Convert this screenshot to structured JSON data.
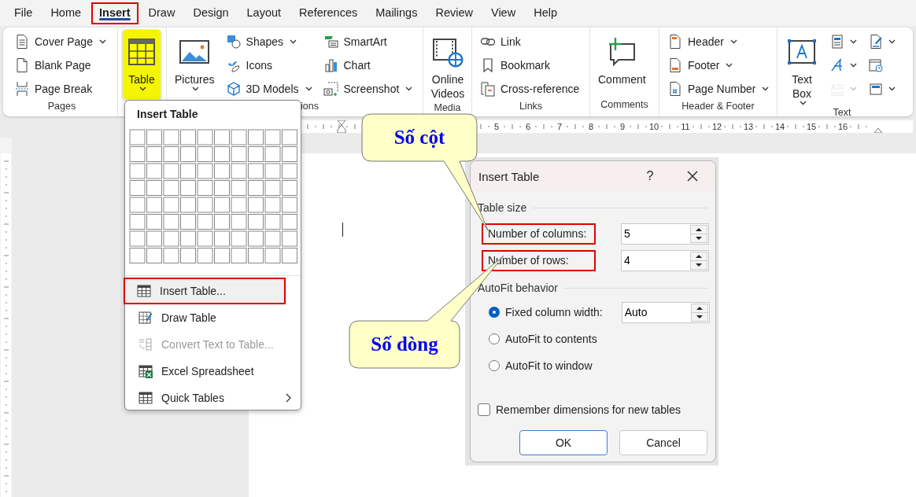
{
  "menu_tabs": [
    {
      "label": "File",
      "selected": false,
      "outlined": false
    },
    {
      "label": "Home",
      "selected": false,
      "outlined": false
    },
    {
      "label": "Insert",
      "selected": true,
      "outlined": true
    },
    {
      "label": "Draw",
      "selected": false,
      "outlined": false
    },
    {
      "label": "Design",
      "selected": false,
      "outlined": false
    },
    {
      "label": "Layout",
      "selected": false,
      "outlined": false
    },
    {
      "label": "References",
      "selected": false,
      "outlined": false
    },
    {
      "label": "Mailings",
      "selected": false,
      "outlined": false
    },
    {
      "label": "Review",
      "selected": false,
      "outlined": false
    },
    {
      "label": "View",
      "selected": false,
      "outlined": false
    },
    {
      "label": "Help",
      "selected": false,
      "outlined": false
    }
  ],
  "ribbon": {
    "groups": [
      {
        "label": "Pages",
        "items": [
          {
            "kind": "small",
            "label": "Cover Page",
            "dropdown": true
          },
          {
            "kind": "small",
            "label": "Blank Page",
            "dropdown": false
          },
          {
            "kind": "small",
            "label": "Page Break",
            "dropdown": false
          }
        ]
      },
      {
        "items": [
          {
            "kind": "large",
            "label": "Table",
            "dropdown": true,
            "highlighted": true
          }
        ]
      },
      {
        "label": "ions",
        "items": [
          {
            "kind": "large",
            "label": "Pictures",
            "dropdown": true,
            "highlighted": false
          },
          {
            "kind": "small",
            "label": "Shapes",
            "dropdown": true
          },
          {
            "kind": "small",
            "label": "Icons",
            "dropdown": false
          },
          {
            "kind": "small",
            "label": "3D Models",
            "dropdown": true
          },
          {
            "kind": "small",
            "label": "SmartArt",
            "dropdown": false
          },
          {
            "kind": "small",
            "label": "Chart",
            "dropdown": false
          },
          {
            "kind": "small",
            "label": "Screenshot",
            "dropdown": true
          }
        ]
      },
      {
        "label": "Media",
        "items": [
          {
            "kind": "large",
            "label": "Online Videos",
            "dropdown": false,
            "highlighted": false
          }
        ]
      },
      {
        "label": "Links",
        "items": [
          {
            "kind": "small",
            "label": "Link",
            "dropdown": false
          },
          {
            "kind": "small",
            "label": "Bookmark",
            "dropdown": false
          },
          {
            "kind": "small",
            "label": "Cross-reference",
            "dropdown": false
          }
        ]
      },
      {
        "label": "Comments",
        "items": [
          {
            "kind": "large",
            "label": "Comment",
            "dropdown": false,
            "highlighted": false
          }
        ]
      },
      {
        "label": "Header & Footer",
        "items": [
          {
            "kind": "small",
            "label": "Header",
            "dropdown": true
          },
          {
            "kind": "small",
            "label": "Footer",
            "dropdown": true
          },
          {
            "kind": "small",
            "label": "Page Number",
            "dropdown": true
          }
        ]
      },
      {
        "label": "Text",
        "items": [
          {
            "kind": "large",
            "label": "Text Box",
            "dropdown": true,
            "highlighted": false
          },
          {
            "kind": "icon",
            "dropdown": true,
            "disabled": false
          },
          {
            "kind": "icon",
            "dropdown": true,
            "disabled": false
          },
          {
            "kind": "icon",
            "dropdown": true,
            "disabled": true
          },
          {
            "kind": "icon",
            "dropdown": true,
            "disabled": false
          },
          {
            "kind": "icon",
            "dropdown": false,
            "disabled": false
          },
          {
            "kind": "icon",
            "dropdown": true,
            "disabled": false
          }
        ]
      }
    ]
  },
  "ruler": {
    "numbers": [
      "5",
      "6",
      "7",
      "8",
      "9",
      "10",
      "11",
      "12",
      "13",
      "14",
      "15",
      "16"
    ]
  },
  "table_menu": {
    "title": "Insert Table",
    "items": [
      {
        "label": "Insert Table...",
        "highlighted": true,
        "outlined": true,
        "disabled": false,
        "submenu": false
      },
      {
        "label": "Draw Table",
        "highlighted": false,
        "outlined": false,
        "disabled": false,
        "submenu": false
      },
      {
        "label": "Convert Text to Table...",
        "highlighted": false,
        "outlined": false,
        "disabled": true,
        "submenu": false
      },
      {
        "label": "Excel Spreadsheet",
        "highlighted": false,
        "outlined": false,
        "disabled": false,
        "submenu": false
      },
      {
        "label": "Quick Tables",
        "highlighted": false,
        "outlined": false,
        "disabled": false,
        "submenu": true
      }
    ]
  },
  "dialog": {
    "title": "Insert Table",
    "help": "?",
    "table_size": {
      "heading": "Table size",
      "fields": [
        {
          "label": "Number of columns:",
          "value": "5",
          "outlined": true
        },
        {
          "label": "Number of rows:",
          "value": "4",
          "outlined": true
        }
      ]
    },
    "autofit": {
      "heading": "AutoFit behavior",
      "options": [
        {
          "label": "Fixed column width:",
          "selected": true,
          "value": "Auto"
        },
        {
          "label": "AutoFit to contents",
          "selected": false
        },
        {
          "label": "AutoFit to window",
          "selected": false
        }
      ]
    },
    "remember": {
      "label": "Remember dimensions for new tables",
      "checked": false
    },
    "buttons": [
      {
        "label": "OK",
        "default": true
      },
      {
        "label": "Cancel",
        "default": false
      }
    ]
  },
  "callouts": [
    {
      "text": "Số cột"
    },
    {
      "text": "Số dòng"
    }
  ]
}
